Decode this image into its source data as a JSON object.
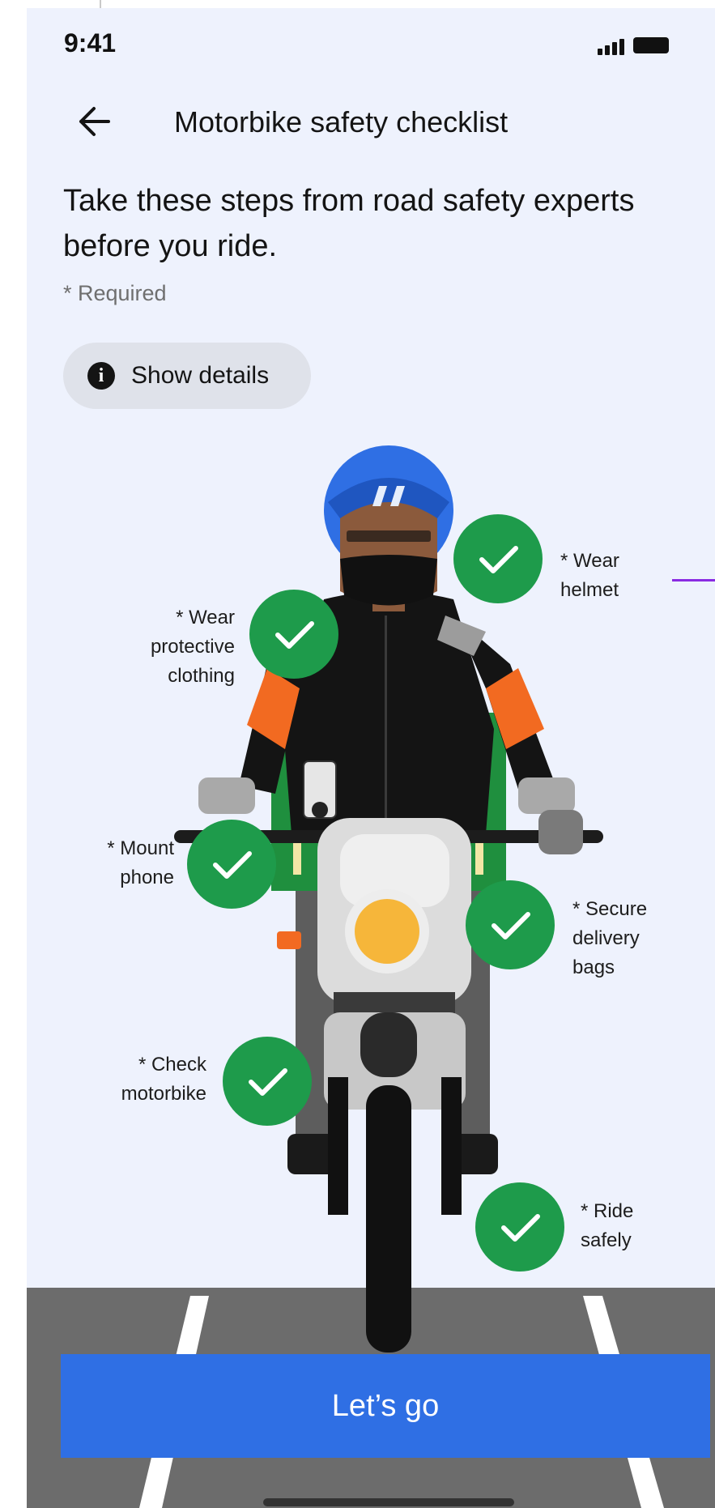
{
  "status_bar": {
    "time": "9:41"
  },
  "header": {
    "back_icon": "arrow-left-icon",
    "title": "Motorbike safety checklist"
  },
  "intro": {
    "heading": "Take these steps from road safety experts before you ride.",
    "required_note": "* Required"
  },
  "details_button": {
    "icon": "info-icon",
    "label": "Show details"
  },
  "checklist": [
    {
      "label_lines": [
        "* Wear",
        "helmet"
      ],
      "checked": true
    },
    {
      "label_lines": [
        "* Wear",
        "protective",
        "clothing"
      ],
      "checked": true
    },
    {
      "label_lines": [
        "* Mount",
        "phone"
      ],
      "checked": true
    },
    {
      "label_lines": [
        "* Secure",
        "delivery",
        "bags"
      ],
      "checked": true
    },
    {
      "label_lines": [
        "* Check",
        "motorbike"
      ],
      "checked": true
    },
    {
      "label_lines": [
        "* Ride",
        "safely"
      ],
      "checked": true
    }
  ],
  "cta": {
    "label": "Let’s go"
  },
  "colors": {
    "background": "#eef2fd",
    "check_green": "#1e9b4b",
    "cta_blue": "#2f6fe4",
    "road": "#6c6c6c"
  }
}
